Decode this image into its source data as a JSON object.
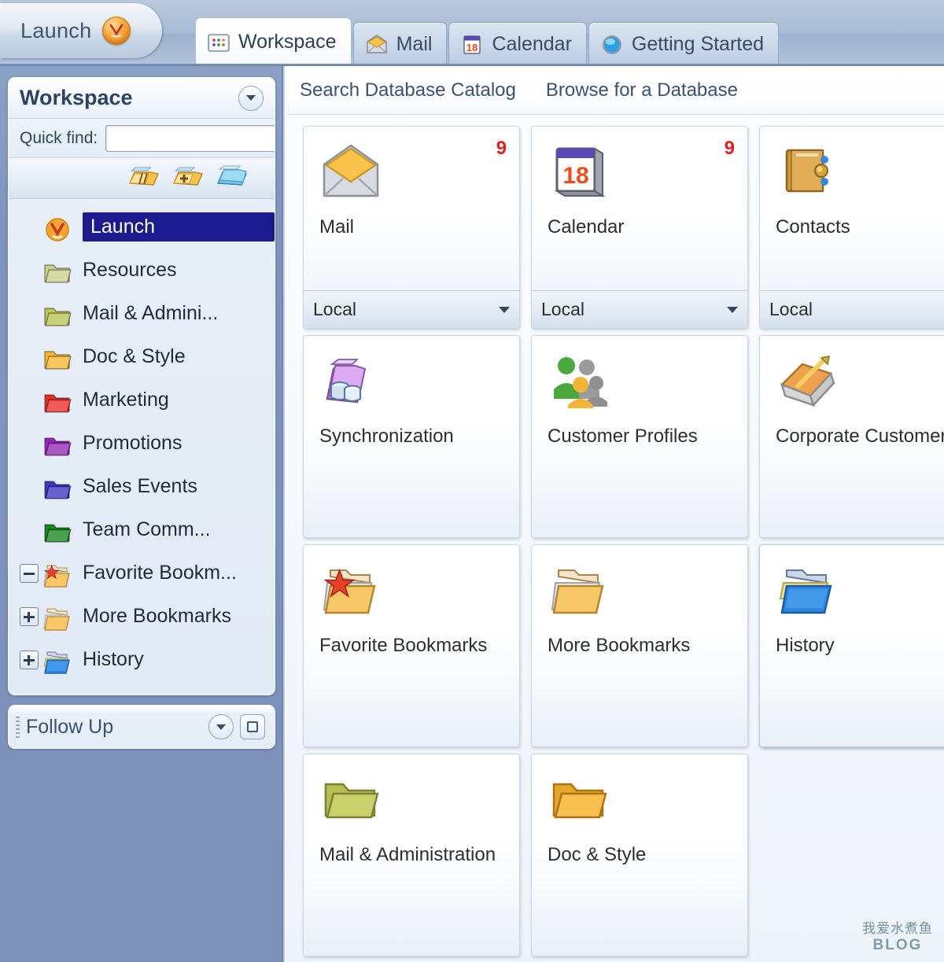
{
  "app": {
    "launch_button": "Launch",
    "launch_icon": "lotus-notes-orb-icon"
  },
  "tabs": [
    {
      "label": "Workspace",
      "icon": "workspace-icon",
      "active": true
    },
    {
      "label": "Mail",
      "icon": "mail-envelope-icon",
      "active": false
    },
    {
      "label": "Calendar",
      "icon": "calendar-18-icon",
      "active": false
    },
    {
      "label": "Getting Started",
      "icon": "blue-sphere-icon",
      "active": false
    }
  ],
  "sidebar": {
    "panel_title": "Workspace",
    "panel_menu_icon": "chevron-down-icon",
    "quick_find_label": "Quick find:",
    "quick_find_value": "",
    "quick_find_placeholder": "",
    "toolbar": [
      {
        "name": "sort-folders-icon"
      },
      {
        "name": "add-folder-icon"
      },
      {
        "name": "blue-folders-icon"
      }
    ],
    "tree": [
      {
        "label": "Launch",
        "icon": "launch-orb-icon",
        "color": "#f6a62c",
        "twisty": "none",
        "selected": true
      },
      {
        "label": "Resources",
        "icon": "folder-icon",
        "color": "#c9cf8e",
        "twisty": "none",
        "selected": false
      },
      {
        "label": "Mail & Admini...",
        "icon": "folder-icon",
        "color": "#bcc457",
        "twisty": "none",
        "selected": false
      },
      {
        "label": "Doc & Style",
        "icon": "folder-icon",
        "color": "#f5b731",
        "twisty": "none",
        "selected": false
      },
      {
        "label": "Marketing",
        "icon": "folder-icon",
        "color": "#e8302a",
        "twisty": "none",
        "selected": false
      },
      {
        "label": "Promotions",
        "icon": "folder-icon",
        "color": "#9428b4",
        "twisty": "none",
        "selected": false
      },
      {
        "label": "Sales Events",
        "icon": "folder-icon",
        "color": "#3c37c0",
        "twisty": "none",
        "selected": false
      },
      {
        "label": "Team Comm...",
        "icon": "folder-icon",
        "color": "#16871f",
        "twisty": "none",
        "selected": false
      },
      {
        "label": "Favorite Bookm...",
        "icon": "favorite-folder-icon",
        "color": "#f5c06a",
        "twisty": "minus",
        "selected": false
      },
      {
        "label": "More Bookmarks",
        "icon": "folder-stack-icon",
        "color": "#f5b02e",
        "twisty": "plus",
        "selected": false
      },
      {
        "label": "History",
        "icon": "history-folder-icon",
        "color": "#2f7ddc",
        "twisty": "plus",
        "selected": false
      }
    ],
    "follow_up": {
      "title": "Follow Up",
      "menu_icon": "chevron-down-icon",
      "restore_icon": "restore-window-icon"
    }
  },
  "main": {
    "actions": [
      {
        "label": "Search Database Catalog"
      },
      {
        "label": "Browse for a Database"
      }
    ],
    "tiles": [
      {
        "title": "Mail",
        "icon": "mail-envelope-icon",
        "badge": "9",
        "location": "Local",
        "has_dropdown": true
      },
      {
        "title": "Calendar",
        "icon": "calendar-18-icon",
        "badge": "9",
        "location": "Local",
        "has_dropdown": true
      },
      {
        "title": "Contacts",
        "icon": "address-book-icon",
        "badge": "",
        "location": "Local",
        "has_dropdown": false
      },
      {
        "title": "Synchronization",
        "icon": "sync-database-icon",
        "badge": "",
        "location": "",
        "has_dropdown": false
      },
      {
        "title": "Customer Profiles",
        "icon": "people-group-icon",
        "badge": "",
        "location": "",
        "has_dropdown": false
      },
      {
        "title": "Corporate Customers",
        "icon": "book-pencil-icon",
        "badge": "",
        "location": "",
        "has_dropdown": false
      },
      {
        "title": "Favorite Bookmarks",
        "icon": "favorite-folder-icon",
        "badge": "",
        "location": "",
        "has_dropdown": false
      },
      {
        "title": "More Bookmarks",
        "icon": "folder-stack-icon",
        "badge": "",
        "location": "",
        "has_dropdown": false
      },
      {
        "title": "History",
        "icon": "history-folder-icon",
        "badge": "",
        "location": "",
        "has_dropdown": false
      },
      {
        "title": "Mail & Administration",
        "icon": "folder-olive-icon",
        "badge": "",
        "location": "",
        "has_dropdown": false
      },
      {
        "title": "Doc & Style",
        "icon": "folder-orange-icon",
        "badge": "",
        "location": "",
        "has_dropdown": false
      }
    ]
  },
  "watermark": {
    "cjk": "我爱水煮鱼",
    "blog": "BLOG"
  },
  "colors": {
    "sidebar_bg": "#7e94bc",
    "selection": "#1b1b8f",
    "badge_red": "#e02020",
    "link_text": "#3b5172"
  }
}
